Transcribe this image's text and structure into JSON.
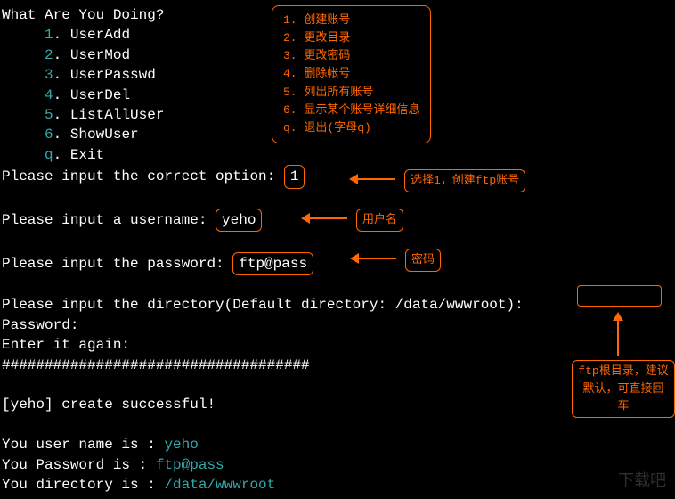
{
  "title": "What Are You Doing?",
  "menu": [
    {
      "num": "1",
      "label": "UserAdd"
    },
    {
      "num": "2",
      "label": "UserMod"
    },
    {
      "num": "3",
      "label": "UserPasswd"
    },
    {
      "num": "4",
      "label": "UserDel"
    },
    {
      "num": "5",
      "label": "ListAllUser"
    },
    {
      "num": "6",
      "label": "ShowUser"
    },
    {
      "num": "q",
      "label": "Exit"
    }
  ],
  "legend": {
    "items": [
      "1. 创建账号",
      "2. 更改目录",
      "3. 更改密码",
      "4. 删除帐号",
      "5. 列出所有账号",
      "6. 显示某个账号详细信息",
      "q. 退出(字母q)"
    ]
  },
  "prompts": {
    "option": "Please input the correct option:",
    "option_val": "1",
    "option_annot": "选择1，创建ftp账号",
    "user": "Please input a username:",
    "user_val": "yeho",
    "user_annot": "用户名",
    "pass": "Please input the password:",
    "pass_val": "ftp@pass",
    "pass_annot": "密码",
    "dir": "Please input the directory(Default directory: /data/wwwroot):",
    "dir_annot1": "ftp根目录，建议",
    "dir_annot2": "默认，可直接回车",
    "passlabel": "Password:",
    "again": "Enter it again:",
    "hashes": "####################################"
  },
  "result": {
    "success": "[yeho] create successful!",
    "name_lbl": "You user name is : ",
    "name_val": "yeho",
    "pass_lbl": "You Password is : ",
    "pass_val": "ftp@pass",
    "dir_lbl": "You directory is : ",
    "dir_val": "/data/wwwroot"
  },
  "watermark": "下载吧"
}
